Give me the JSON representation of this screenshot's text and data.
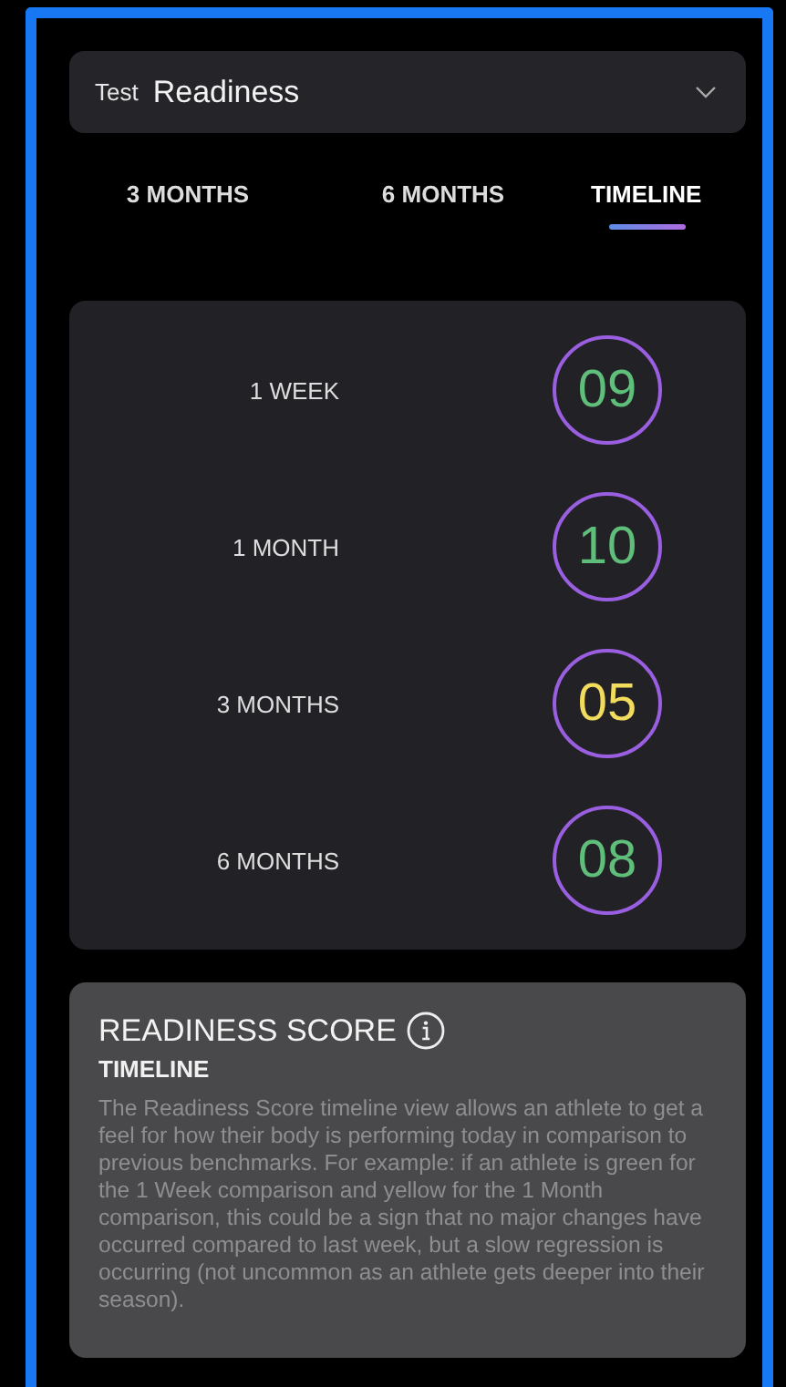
{
  "selector": {
    "label": "Test",
    "value": "Readiness"
  },
  "tabs": [
    {
      "label": "3 MONTHS",
      "selected": false
    },
    {
      "label": "6 MONTHS",
      "selected": false
    },
    {
      "label": "TIMELINE",
      "selected": true
    }
  ],
  "scores": [
    {
      "period": "1 WEEK",
      "score": "09",
      "color": "#5fbf7a"
    },
    {
      "period": "1 MONTH",
      "score": "10",
      "color": "#5fbf7a"
    },
    {
      "period": "3 MONTHS",
      "score": "05",
      "color": "#f2dc5d"
    },
    {
      "period": "6 MONTHS",
      "score": "08",
      "color": "#5fbf7a"
    }
  ],
  "info": {
    "title": "READINESS SCORE",
    "subtitle": "TIMELINE",
    "body": "The Readiness Score timeline view allows an athlete to get a feel for how their body is performing today in comparison to previous benchmarks. For example: if an athlete is green for the 1 Week comparison and yellow for the 1 Month comparison, this could be a sign that no major changes have occurred compared to last week, but a slow regression is occurring (not uncommon as an athlete gets deeper into their season)."
  }
}
